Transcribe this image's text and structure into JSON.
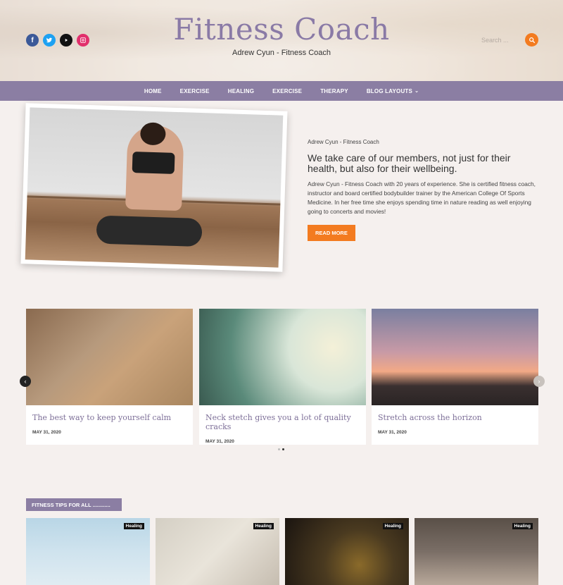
{
  "header": {
    "site_title": "Fitness Coach",
    "tagline": "Adrew Cyun - Fitness Coach",
    "search_placeholder": "Search ...",
    "socials": [
      {
        "name": "facebook-icon",
        "color": "#3b5998",
        "glyph": "f"
      },
      {
        "name": "twitter-icon",
        "color": "#1da1f2"
      },
      {
        "name": "youtube-icon",
        "color": "#111111"
      },
      {
        "name": "instagram-icon",
        "color": "#e1306c"
      }
    ]
  },
  "nav": {
    "items": [
      "HOME",
      "EXERCISE",
      "HEALING",
      "EXERCISE",
      "THERAPY",
      "BLOG LAYOUTS"
    ]
  },
  "feature": {
    "eyebrow": "Adrew Cyun - Fitness Coach",
    "headline": "We take care of our members, not just for their health, but also for their wellbeing.",
    "body": "Adrew Cyun - Fitness Coach with 20 years of experience. She is certified fitness coach, instructor and board certified bodybuilder trainer by the American College Of Sports Medicine. In her free time she enjoys spending time in nature reading as well enjoying going to concerts and movies!",
    "button": "READ MORE"
  },
  "carousel": {
    "cards": [
      {
        "title": "The best way to keep yourself calm",
        "date": "MAY 31, 2020"
      },
      {
        "title": "Neck stetch gives you a lot of quality cracks",
        "date": "MAY 31, 2020"
      },
      {
        "title": "Stretch across the horizon",
        "date": "MAY 31, 2020"
      }
    ]
  },
  "section": {
    "label": "FITNESS TIPS FOR ALL ............"
  },
  "tips": [
    {
      "badge": "Healing"
    },
    {
      "badge": "Healing"
    },
    {
      "badge": "Healing"
    },
    {
      "badge": "Healing"
    }
  ],
  "colors": {
    "accent": "#f37b20",
    "brand": "#8b7ea3",
    "title": "#8a7aa6"
  }
}
